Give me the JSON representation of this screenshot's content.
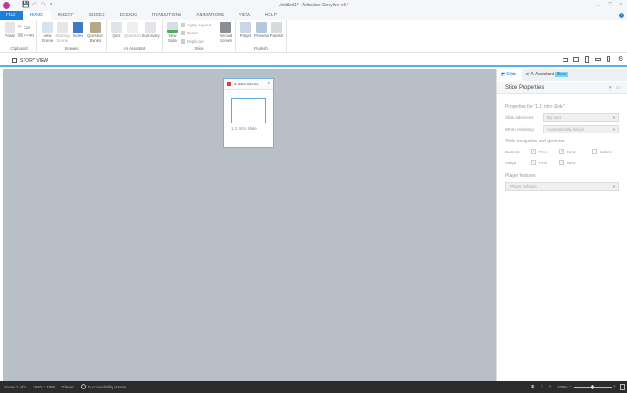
{
  "window": {
    "title": "Untitled1* - Articulate Storyline",
    "edition": "x64",
    "min": "_",
    "max": "❐",
    "close": "✕"
  },
  "quick_access": {
    "save": "💾",
    "undo": "↶",
    "redo": "↷",
    "more": "▾"
  },
  "tabs": [
    "FILE",
    "HOME",
    "INSERT",
    "SLIDES",
    "DESIGN",
    "TRANSITIONS",
    "ANIMATIONS",
    "VIEW",
    "HELP"
  ],
  "help_icon": "?",
  "ribbon": {
    "clipboard": {
      "label": "Clipboard",
      "paste": "Paste",
      "cut": "Cut",
      "copy": "Copy"
    },
    "scenes": {
      "label": "Scenes",
      "new_scene": "New Scene",
      "starting_scene": "Starting Scene",
      "index": "Index",
      "question_banks": "Question Banks"
    },
    "ai": {
      "label": "AI Assistant",
      "quiz": "Quiz",
      "question": "Question",
      "summary": "Summary"
    },
    "slide": {
      "label": "Slide",
      "new_slide": "New Slide",
      "apply_layout": "Apply Layout",
      "reset": "Reset",
      "duplicate": "Duplicate",
      "record_screen": "Record Screen"
    },
    "publish": {
      "label": "Publish",
      "player": "Player",
      "preview": "Preview",
      "publish": "Publish"
    }
  },
  "story_view": {
    "label": "STORY VIEW"
  },
  "scene": {
    "title": "1 Intro Scene",
    "slide_label": "1.1 Intro Slide"
  },
  "panel": {
    "tabs": {
      "slide": "Slide",
      "ai": "AI Assistant",
      "beta": "Beta"
    },
    "title": "Slide Properties",
    "properties_for": "Properties for \"1.1 Intro Slide\"",
    "slide_advances_label": "Slide advances:",
    "slide_advances_value": "By user",
    "when_revisiting_label": "When revisiting:",
    "when_revisiting_value": "Automatically decide",
    "nav_heading": "Slide navigation and gestures",
    "buttons_label": "Buttons:",
    "swipe_label": "Swipe:",
    "prev": "Prev",
    "next": "Next",
    "submit": "Submit",
    "buttons": {
      "prev": true,
      "next": true,
      "submit": false
    },
    "swipe": {
      "prev": true,
      "next": true
    },
    "player_heading": "Player features",
    "player_value": "Player defaults"
  },
  "status": {
    "scene": "Scene 1 of 1",
    "size": "1920 × 1080",
    "theme": "\"Clean\"",
    "accessibility": "0 Accessibility Issues",
    "zoom": "100%"
  }
}
